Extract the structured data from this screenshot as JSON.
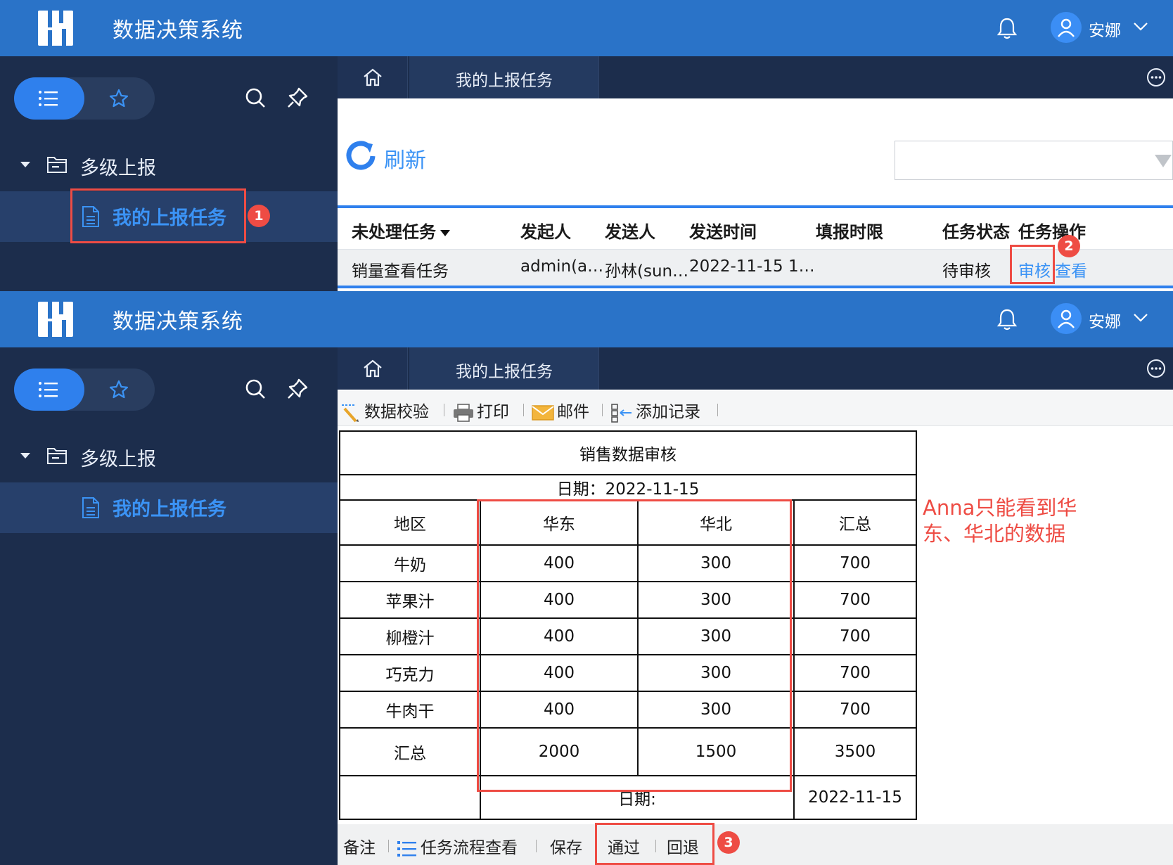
{
  "app": {
    "title": "数据决策系统",
    "user": "安娜",
    "brand_color": "#2a73c8",
    "sidebar_color": "#1c2d4c",
    "accent_color": "#2f80ed",
    "callout_color": "#ee4c44"
  },
  "sidebar": {
    "folder_label": "多级上报",
    "item_label": "我的上报任务"
  },
  "tabs": {
    "active_label": "我的上报任务"
  },
  "task_list": {
    "refresh_label": "刷新",
    "columns": [
      "未处理任务",
      "发起人",
      "发送人",
      "发送时间",
      "填报时限",
      "任务状态",
      "任务操作"
    ],
    "rows": [
      {
        "name": "销量查看任务",
        "initiator": "admin(a…",
        "sender": "孙林(sun…",
        "send_time": "2022-11-15 1…",
        "deadline": "",
        "status": "待审核",
        "action_review": "审核",
        "action_view": "查看"
      }
    ]
  },
  "toolbar": {
    "validate": "数据校验",
    "print": "打印",
    "mail": "邮件",
    "add_record": "添加记录"
  },
  "report": {
    "title": "销售数据审核",
    "date_line": "日期：2022-11-15",
    "headers": [
      "地区",
      "华东",
      "华北",
      "汇总"
    ],
    "rows": [
      [
        "牛奶",
        "400",
        "300",
        "700"
      ],
      [
        "苹果汁",
        "400",
        "300",
        "700"
      ],
      [
        "柳橙汁",
        "400",
        "300",
        "700"
      ],
      [
        "巧克力",
        "400",
        "300",
        "700"
      ],
      [
        "牛肉干",
        "400",
        "300",
        "700"
      ],
      [
        "汇总",
        "2000",
        "1500",
        "3500"
      ]
    ],
    "footer_label": "日期:",
    "footer_value": "2022-11-15"
  },
  "annotation": {
    "text": "Anna只能看到华东、华北的数据"
  },
  "callouts": [
    "1",
    "2",
    "3"
  ],
  "bottom_bar": {
    "note": "备注",
    "flow": "任务流程查看",
    "save": "保存",
    "pass": "通过",
    "reject": "回退"
  }
}
